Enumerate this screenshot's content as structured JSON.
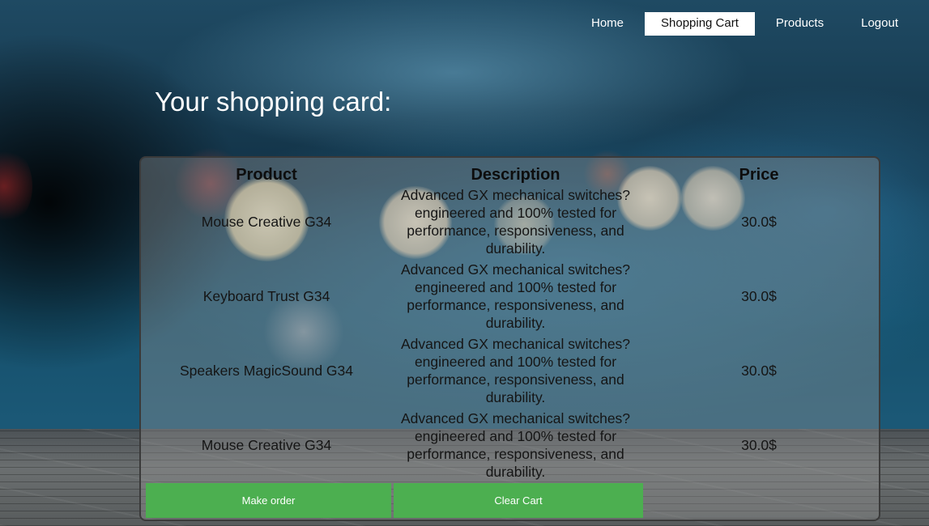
{
  "nav": {
    "items": [
      {
        "label": "Home",
        "active": false
      },
      {
        "label": "Shopping Cart",
        "active": true
      },
      {
        "label": "Products",
        "active": false
      },
      {
        "label": "Logout",
        "active": false
      }
    ]
  },
  "page_title": "Your shopping card:",
  "cart": {
    "headers": {
      "product": "Product",
      "description": "Description",
      "price": "Price"
    },
    "rows": [
      {
        "product": "Mouse Creative G34",
        "description": "Advanced GX mechanical switches?engineered and 100% tested for performance, responsiveness, and durability.",
        "price": "30.0$"
      },
      {
        "product": "Keyboard Trust G34",
        "description": "Advanced GX mechanical switches?engineered and 100% tested for performance, responsiveness, and durability.",
        "price": "30.0$"
      },
      {
        "product": "Speakers MagicSound G34",
        "description": "Advanced GX mechanical switches?engineered and 100% tested for performance, responsiveness, and durability.",
        "price": "30.0$"
      },
      {
        "product": "Mouse Creative G34",
        "description": "Advanced GX mechanical switches?engineered and 100% tested for performance, responsiveness, and durability.",
        "price": "30.0$"
      }
    ]
  },
  "actions": {
    "make_order_label": "Make order",
    "clear_cart_label": "Clear Cart"
  },
  "colors": {
    "accent_button": "#4caf50",
    "nav_active_bg": "#ffffff"
  }
}
